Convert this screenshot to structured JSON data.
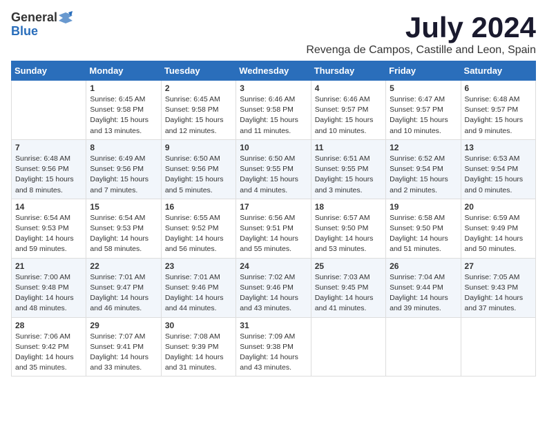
{
  "logo": {
    "text_general": "General",
    "text_blue": "Blue"
  },
  "title": "July 2024",
  "subtitle": "Revenga de Campos, Castille and Leon, Spain",
  "days_of_week": [
    "Sunday",
    "Monday",
    "Tuesday",
    "Wednesday",
    "Thursday",
    "Friday",
    "Saturday"
  ],
  "weeks": [
    [
      {
        "day": "",
        "content": ""
      },
      {
        "day": "1",
        "content": "Sunrise: 6:45 AM\nSunset: 9:58 PM\nDaylight: 15 hours and 13 minutes."
      },
      {
        "day": "2",
        "content": "Sunrise: 6:45 AM\nSunset: 9:58 PM\nDaylight: 15 hours and 12 minutes."
      },
      {
        "day": "3",
        "content": "Sunrise: 6:46 AM\nSunset: 9:58 PM\nDaylight: 15 hours and 11 minutes."
      },
      {
        "day": "4",
        "content": "Sunrise: 6:46 AM\nSunset: 9:57 PM\nDaylight: 15 hours and 10 minutes."
      },
      {
        "day": "5",
        "content": "Sunrise: 6:47 AM\nSunset: 9:57 PM\nDaylight: 15 hours and 10 minutes."
      },
      {
        "day": "6",
        "content": "Sunrise: 6:48 AM\nSunset: 9:57 PM\nDaylight: 15 hours and 9 minutes."
      }
    ],
    [
      {
        "day": "7",
        "content": "Sunrise: 6:48 AM\nSunset: 9:56 PM\nDaylight: 15 hours and 8 minutes."
      },
      {
        "day": "8",
        "content": "Sunrise: 6:49 AM\nSunset: 9:56 PM\nDaylight: 15 hours and 7 minutes."
      },
      {
        "day": "9",
        "content": "Sunrise: 6:50 AM\nSunset: 9:56 PM\nDaylight: 15 hours and 5 minutes."
      },
      {
        "day": "10",
        "content": "Sunrise: 6:50 AM\nSunset: 9:55 PM\nDaylight: 15 hours and 4 minutes."
      },
      {
        "day": "11",
        "content": "Sunrise: 6:51 AM\nSunset: 9:55 PM\nDaylight: 15 hours and 3 minutes."
      },
      {
        "day": "12",
        "content": "Sunrise: 6:52 AM\nSunset: 9:54 PM\nDaylight: 15 hours and 2 minutes."
      },
      {
        "day": "13",
        "content": "Sunrise: 6:53 AM\nSunset: 9:54 PM\nDaylight: 15 hours and 0 minutes."
      }
    ],
    [
      {
        "day": "14",
        "content": "Sunrise: 6:54 AM\nSunset: 9:53 PM\nDaylight: 14 hours and 59 minutes."
      },
      {
        "day": "15",
        "content": "Sunrise: 6:54 AM\nSunset: 9:53 PM\nDaylight: 14 hours and 58 minutes."
      },
      {
        "day": "16",
        "content": "Sunrise: 6:55 AM\nSunset: 9:52 PM\nDaylight: 14 hours and 56 minutes."
      },
      {
        "day": "17",
        "content": "Sunrise: 6:56 AM\nSunset: 9:51 PM\nDaylight: 14 hours and 55 minutes."
      },
      {
        "day": "18",
        "content": "Sunrise: 6:57 AM\nSunset: 9:50 PM\nDaylight: 14 hours and 53 minutes."
      },
      {
        "day": "19",
        "content": "Sunrise: 6:58 AM\nSunset: 9:50 PM\nDaylight: 14 hours and 51 minutes."
      },
      {
        "day": "20",
        "content": "Sunrise: 6:59 AM\nSunset: 9:49 PM\nDaylight: 14 hours and 50 minutes."
      }
    ],
    [
      {
        "day": "21",
        "content": "Sunrise: 7:00 AM\nSunset: 9:48 PM\nDaylight: 14 hours and 48 minutes."
      },
      {
        "day": "22",
        "content": "Sunrise: 7:01 AM\nSunset: 9:47 PM\nDaylight: 14 hours and 46 minutes."
      },
      {
        "day": "23",
        "content": "Sunrise: 7:01 AM\nSunset: 9:46 PM\nDaylight: 14 hours and 44 minutes."
      },
      {
        "day": "24",
        "content": "Sunrise: 7:02 AM\nSunset: 9:46 PM\nDaylight: 14 hours and 43 minutes."
      },
      {
        "day": "25",
        "content": "Sunrise: 7:03 AM\nSunset: 9:45 PM\nDaylight: 14 hours and 41 minutes."
      },
      {
        "day": "26",
        "content": "Sunrise: 7:04 AM\nSunset: 9:44 PM\nDaylight: 14 hours and 39 minutes."
      },
      {
        "day": "27",
        "content": "Sunrise: 7:05 AM\nSunset: 9:43 PM\nDaylight: 14 hours and 37 minutes."
      }
    ],
    [
      {
        "day": "28",
        "content": "Sunrise: 7:06 AM\nSunset: 9:42 PM\nDaylight: 14 hours and 35 minutes."
      },
      {
        "day": "29",
        "content": "Sunrise: 7:07 AM\nSunset: 9:41 PM\nDaylight: 14 hours and 33 minutes."
      },
      {
        "day": "30",
        "content": "Sunrise: 7:08 AM\nSunset: 9:39 PM\nDaylight: 14 hours and 31 minutes."
      },
      {
        "day": "31",
        "content": "Sunrise: 7:09 AM\nSunset: 9:38 PM\nDaylight: 14 hours and 43 minutes."
      },
      {
        "day": "",
        "content": ""
      },
      {
        "day": "",
        "content": ""
      },
      {
        "day": "",
        "content": ""
      }
    ]
  ]
}
